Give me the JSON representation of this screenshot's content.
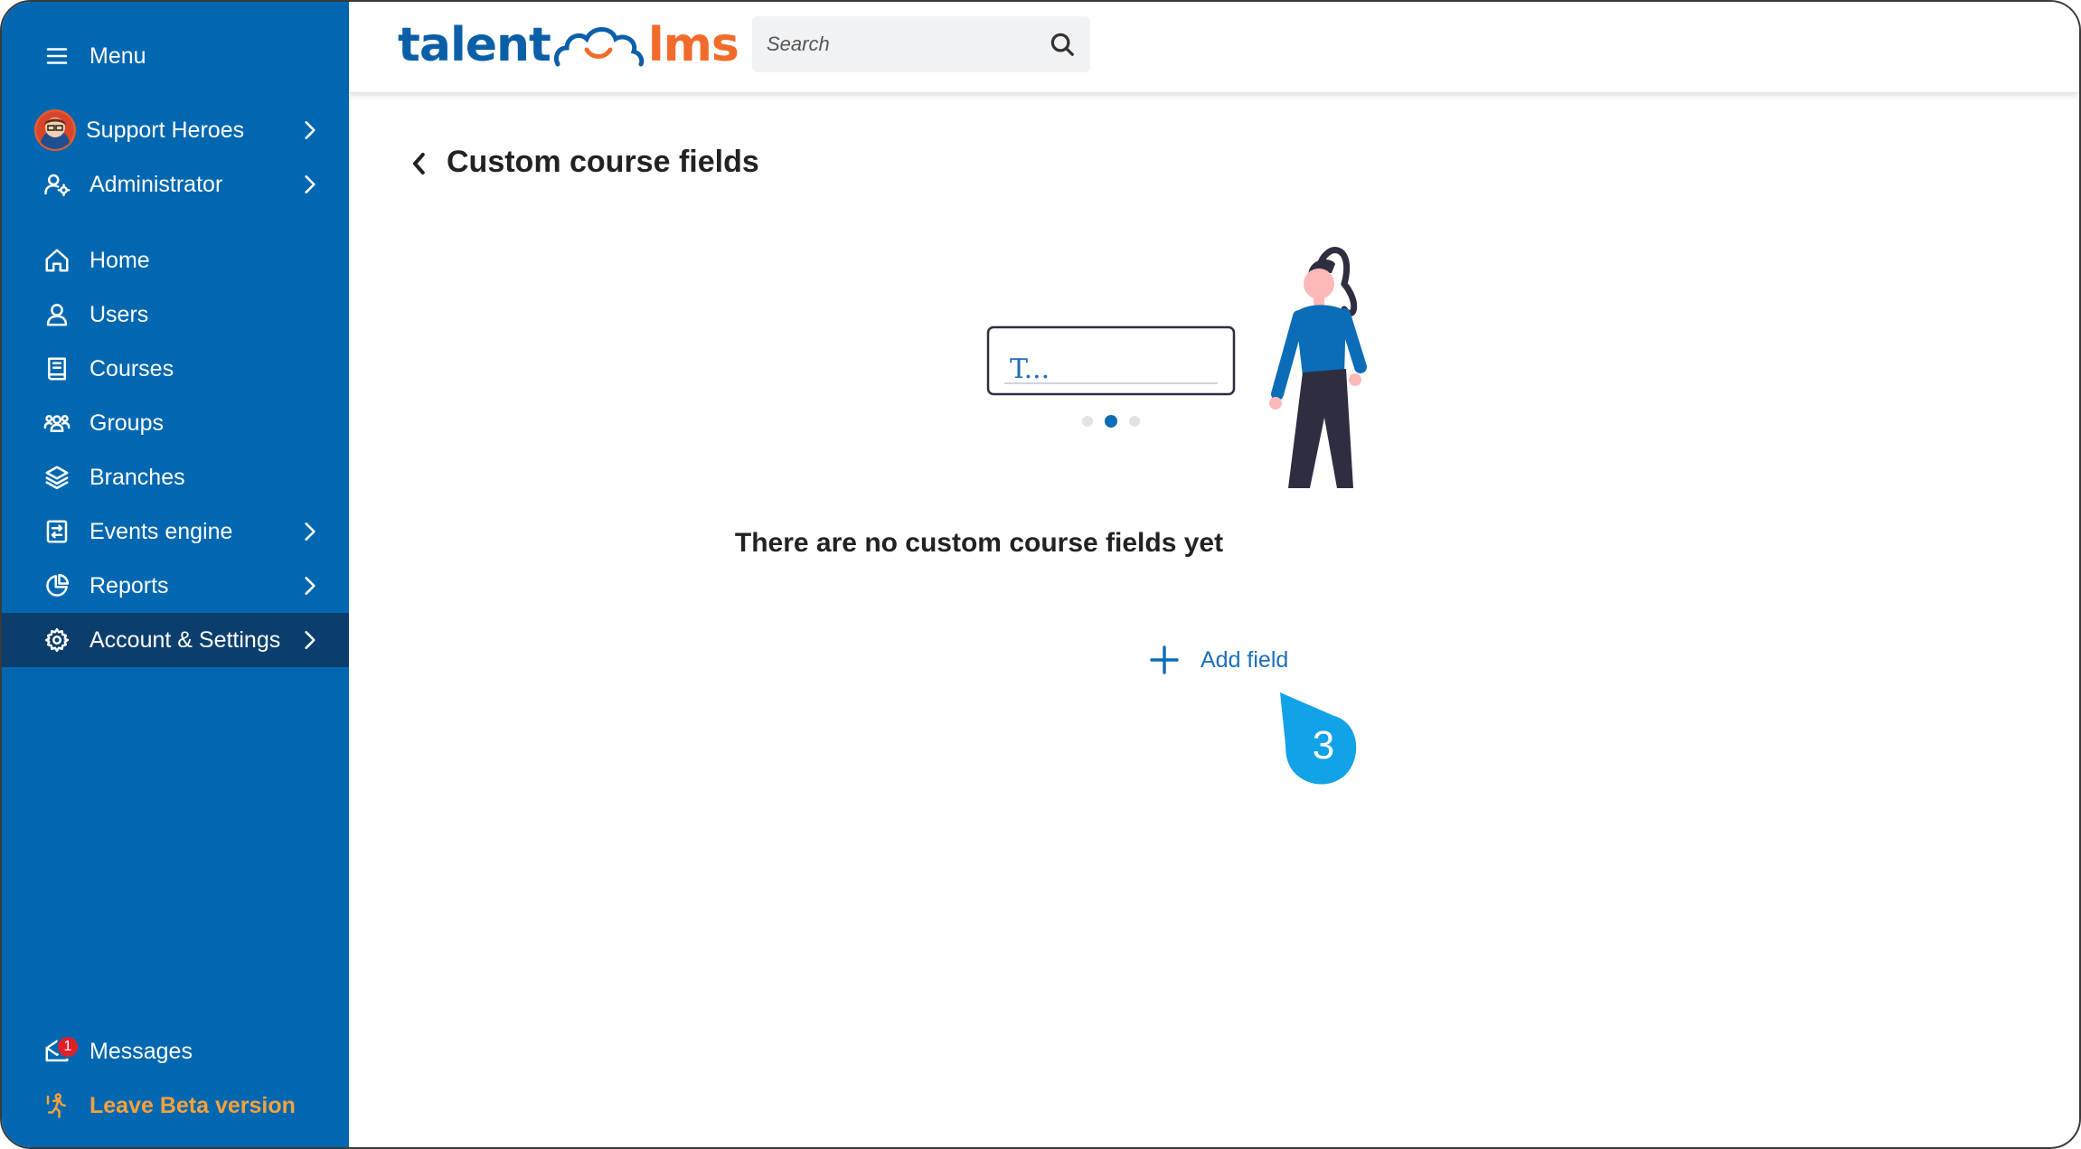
{
  "sidebar": {
    "menu_label": "Menu",
    "items": [
      {
        "label": "Support Heroes"
      },
      {
        "label": "Administrator"
      },
      {
        "label": "Home"
      },
      {
        "label": "Users"
      },
      {
        "label": "Courses"
      },
      {
        "label": "Groups"
      },
      {
        "label": "Branches"
      },
      {
        "label": "Events engine"
      },
      {
        "label": "Reports"
      },
      {
        "label": "Account & Settings"
      }
    ],
    "messages_label": "Messages",
    "messages_badge": "1",
    "leave_beta_label": "Leave Beta version"
  },
  "header": {
    "logo_left": "talent",
    "logo_right": "lms",
    "search_placeholder": "Search"
  },
  "main": {
    "page_title": "Custom course fields",
    "illustration_text": "T...",
    "empty_text": "There are no custom course fields yet",
    "add_field_label": "Add field",
    "step_number": "3"
  },
  "colors": {
    "sidebar_bg": "#0067b0",
    "sidebar_active": "#0b3e6d",
    "accent_orange": "#f26b2a",
    "link_blue": "#1d6fb8",
    "step_bubble": "#12a2e8",
    "badge_red": "#e0202b"
  }
}
